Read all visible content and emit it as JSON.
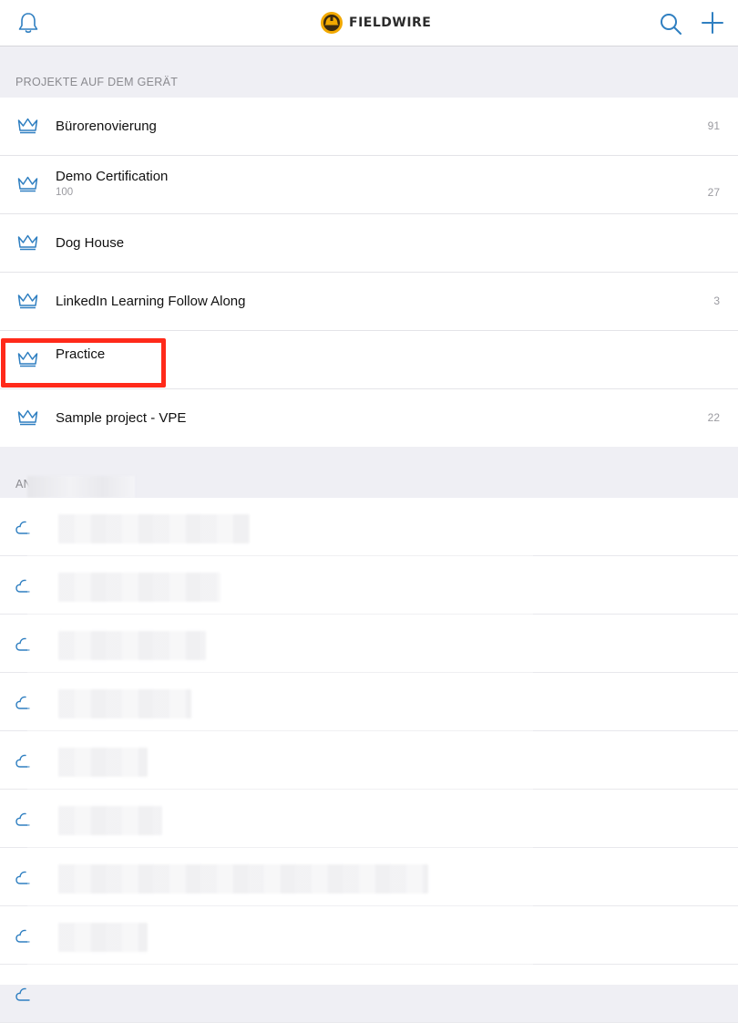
{
  "header": {
    "brand": "FIELDWIRE",
    "icons": {
      "left": "bell-icon",
      "logo": "fieldwire-logo",
      "search": "search-icon",
      "add": "plus-icon"
    },
    "accent_color": "#2f7fc1"
  },
  "device_projects": {
    "section_title": "PROJEKTE AUF DEM GERÄT",
    "items": [
      {
        "name": "Bürorenovierung",
        "subtitle": "",
        "count": "91"
      },
      {
        "name": "Demo Certification",
        "subtitle": "100",
        "count": "27"
      },
      {
        "name": "Dog House",
        "subtitle": "",
        "count": ""
      },
      {
        "name": "LinkedIn Learning Follow Along",
        "subtitle": "",
        "count": "3"
      },
      {
        "name": "Practice",
        "subtitle": "",
        "count": ""
      },
      {
        "name": "Sample project - VPE",
        "subtitle": "",
        "count": "22"
      }
    ]
  },
  "other_projects": {
    "section_title_visible": "AN",
    "row_icon": "cloud-icon",
    "row_count": 9
  },
  "annotation": {
    "highlight_color": "#ff2a1a",
    "highlighted_item": "Practice"
  }
}
